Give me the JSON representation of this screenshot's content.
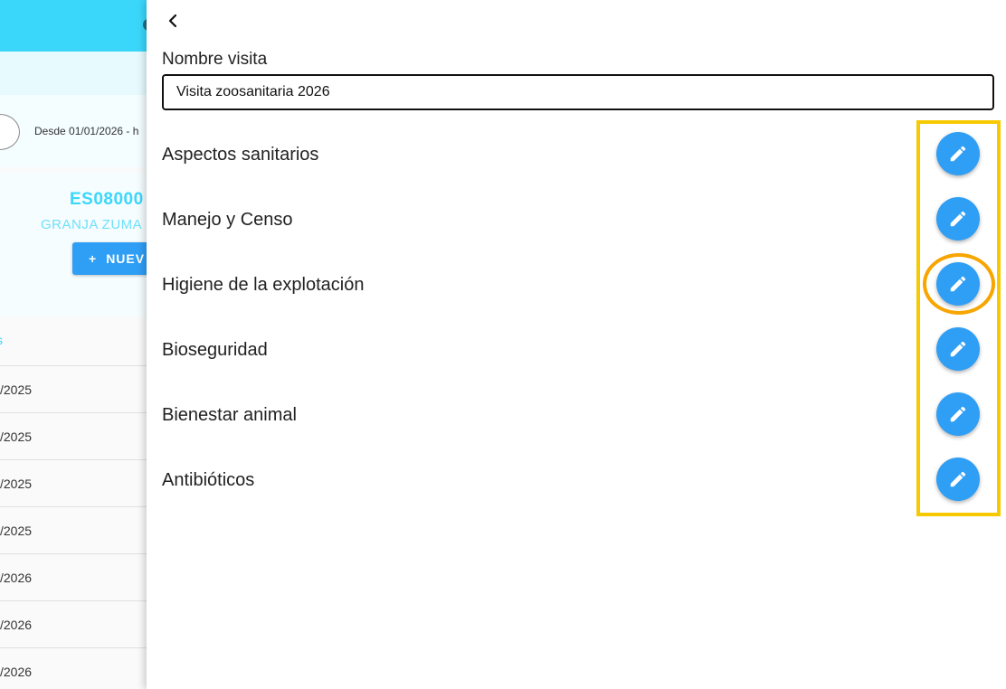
{
  "background_app": {
    "filter_text": "Desde 01/01/2026 - h",
    "farm_code": "ES08000",
    "farm_name": "GRANJA ZUMA",
    "new_button_icon": "+",
    "new_button_label": "NUEV",
    "column_header": "s",
    "rows": [
      "/2025",
      "/2025",
      "/2025",
      "/2025",
      "/2026",
      "/2026",
      "/2026"
    ]
  },
  "drawer": {
    "back_icon": "chevron-left-icon",
    "name_label": "Nombre visita",
    "name_value": "Visita zoosanitaria 2026",
    "sections": [
      {
        "label": "Aspectos sanitarios",
        "icon": "pencil-icon"
      },
      {
        "label": "Manejo y Censo",
        "icon": "pencil-icon"
      },
      {
        "label": "Higiene de la explotación",
        "icon": "pencil-icon"
      },
      {
        "label": "Bioseguridad",
        "icon": "pencil-icon"
      },
      {
        "label": "Bienestar animal",
        "icon": "pencil-icon"
      },
      {
        "label": "Antibióticos",
        "icon": "pencil-icon"
      }
    ]
  },
  "colors": {
    "accent_cyan": "#3ad7fb",
    "button_blue": "#2f9ef5",
    "highlight_yellow": "#f7c900",
    "highlight_orange": "#f7a500"
  }
}
